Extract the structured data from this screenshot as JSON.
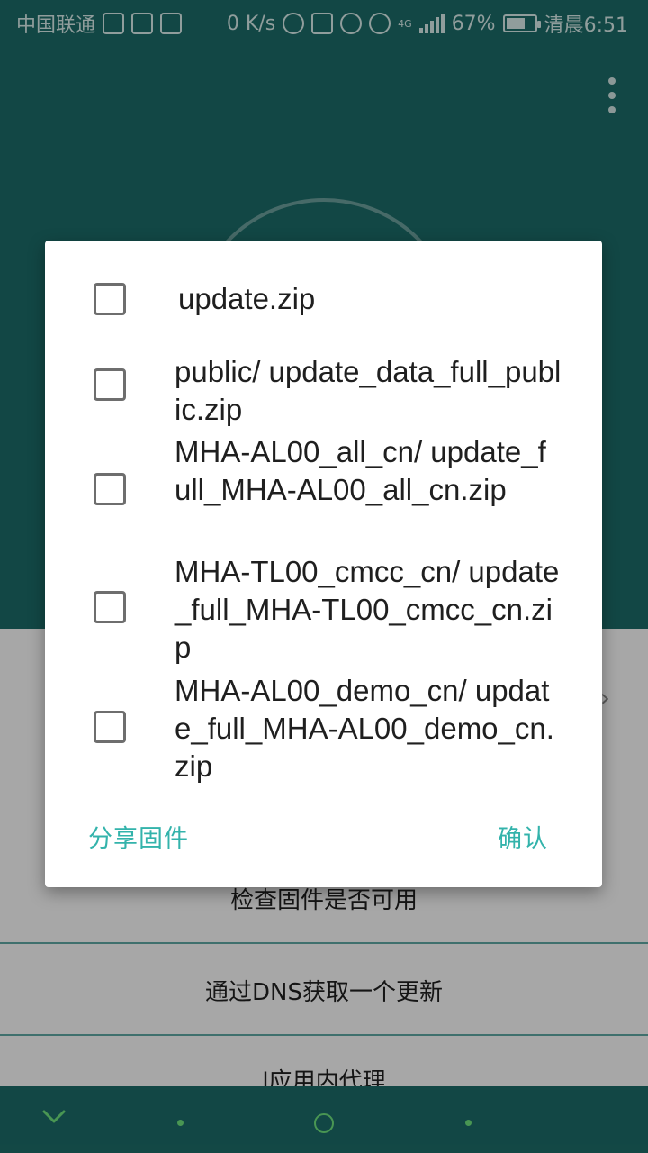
{
  "status_bar": {
    "carrier": "中国联通",
    "net_speed": "0 K/s",
    "network_type": "4G",
    "battery": "67%",
    "battery_level": 0.67,
    "time": "清晨6:51"
  },
  "dialog": {
    "options": [
      {
        "label": " update.zip",
        "checked": false
      },
      {
        "label": "public/ update_data_full_public.zip",
        "checked": false
      },
      {
        "label": "MHA-AL00_all_cn/ update_full_MHA-AL00_all_cn.zip",
        "checked": false
      },
      {
        "label": "MHA-TL00_cmcc_cn/ update_full_MHA-TL00_cmcc_cn.zip",
        "checked": false
      },
      {
        "label": "MHA-AL00_demo_cn/ update_full_MHA-AL00_demo_cn.zip",
        "checked": false
      }
    ],
    "share_label": "分享固件",
    "confirm_label": "确认"
  },
  "background_list": {
    "items": [
      {
        "label": "检查固件是否可用"
      },
      {
        "label": "通过DNS获取一个更新"
      },
      {
        "label": "l应用内代理"
      }
    ]
  },
  "colors": {
    "primary": "#1c6b67",
    "accent": "#33b3ab",
    "nav_accent": "#6de07c"
  }
}
